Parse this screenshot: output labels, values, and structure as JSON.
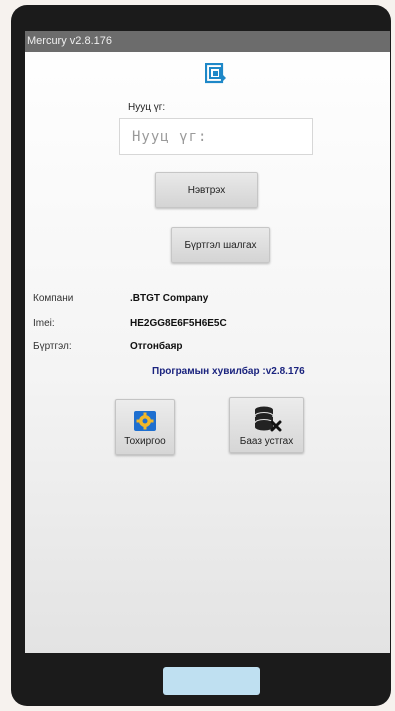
{
  "app": {
    "title": "Mercury v2.8.176"
  },
  "colors": {
    "accent_text": "#1a237e",
    "titlebar": "#6c6c6c",
    "nav_button": "#bfe0f1"
  },
  "password": {
    "label": "Нууц үг:",
    "placeholder": "Нууц үг:"
  },
  "buttons": {
    "login": "Нэвтрэх",
    "register": "Бүртгэл шалгах"
  },
  "info": {
    "company_label": "Компани",
    "company_value": ".BTGT Company",
    "imei_label": "Imei:",
    "imei_value": "HE2GG8E6F5H6E5C",
    "registration_label": "Бүртгэл:",
    "registration_value": "Отгонбаяр"
  },
  "version_text": "Програмын хувилбар :v2.8.176",
  "tools": {
    "settings": {
      "label": "Тохиргоо",
      "icon": "gear-icon"
    },
    "db_clear": {
      "label": "Бааз устгах",
      "icon": "database-delete-icon"
    }
  }
}
